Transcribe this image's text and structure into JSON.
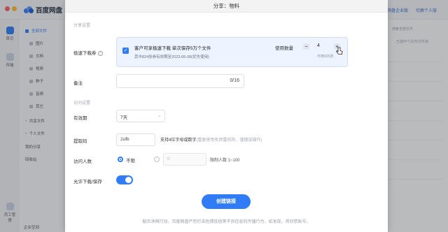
{
  "app": {
    "brand": "百度网盘",
    "top_right": {
      "enterprise": "网盘企业版",
      "switch_user": "切换个人版"
    },
    "rail": [
      {
        "label": "首页"
      },
      {
        "label": "传输"
      }
    ],
    "rail_bottom": {
      "label": "员工管理"
    },
    "sidebar": {
      "items": [
        {
          "label": "全部文件",
          "active": true
        },
        {
          "label": "图片"
        },
        {
          "label": "文档"
        },
        {
          "label": "视频"
        },
        {
          "label": "种子"
        },
        {
          "label": "音频"
        },
        {
          "label": "其它"
        },
        {
          "label": "共享文件"
        },
        {
          "label": "个人文件"
        },
        {
          "label": "我的分享"
        },
        {
          "label": "回收站"
        }
      ],
      "bottom": "企业空间"
    },
    "main_hint": {
      "search": "搜索全部文件",
      "notice": "已选中个文件/文件夹"
    }
  },
  "dialog": {
    "title": "分享：物料",
    "sections": {
      "share": "分享设置",
      "access": "访问设置"
    },
    "speed": {
      "label": "极速下载券",
      "help_icon": "?",
      "checked": true,
      "main_text": "客户可享极速下载 单次保存5万个文件",
      "sub_text": "其中824张券有效期至2022-06-08(优先使用)",
      "qty_label": "使用数量",
      "qty_value": "4",
      "available": "可用925张"
    },
    "note": {
      "label": "备注",
      "count": "0/16"
    },
    "validity": {
      "label": "有效期",
      "value": "7天"
    },
    "code": {
      "label": "提取码",
      "value": "2ufb",
      "hint": "支持4位字母或数字",
      "hint_gray": "(重复使用有泄露风险，谨慎该操作)"
    },
    "visitors": {
      "label": "访问人数",
      "unlimited": "不限",
      "limit_placeholder": "0",
      "limit_text": "限制人数 1~100"
    },
    "download": {
      "label": "允许下载/保存",
      "enabled": true
    },
    "create_button": "创建链接",
    "footer": "配合净网行动，百度网盘严厉打击色情低俗等不良信息的传播行为，如发现，将封禁账号。"
  }
}
